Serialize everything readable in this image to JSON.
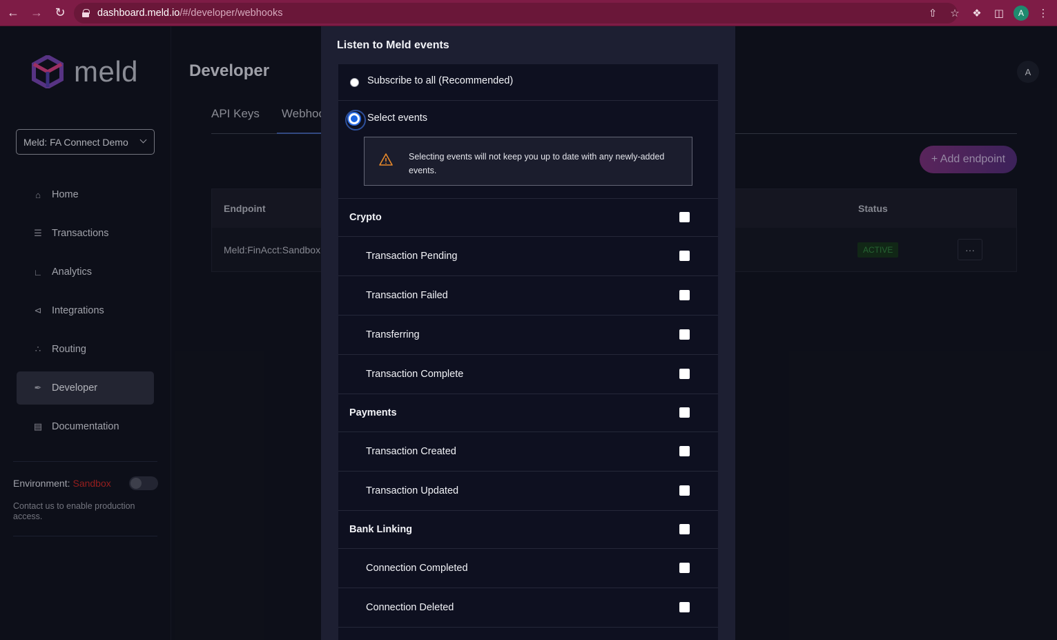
{
  "browser": {
    "url_host": "dashboard.meld.io",
    "url_path": "/#/developer/webhooks",
    "profile_initial": "A"
  },
  "sidebar": {
    "logo_text": "meld",
    "account_select": "Meld: FA Connect Demo",
    "items": [
      {
        "label": "Home",
        "icon": "home-icon"
      },
      {
        "label": "Transactions",
        "icon": "list-icon"
      },
      {
        "label": "Analytics",
        "icon": "chart-icon"
      },
      {
        "label": "Integrations",
        "icon": "share-icon"
      },
      {
        "label": "Routing",
        "icon": "routing-icon"
      },
      {
        "label": "Developer",
        "icon": "wrench-icon"
      },
      {
        "label": "Documentation",
        "icon": "book-icon"
      }
    ],
    "environment_label": "Environment:",
    "environment_value": "Sandbox",
    "environment_help": "Contact us to enable production access."
  },
  "main": {
    "title": "Developer",
    "tabs": [
      "API Keys",
      "Webhooks"
    ],
    "avatar_initial": "A",
    "add_endpoint_label": "+ Add endpoint",
    "table": {
      "headers": {
        "endpoint": "Endpoint",
        "status": "Status"
      },
      "rows": [
        {
          "endpoint": "Meld:FinAcct:Sandbox",
          "status": "ACTIVE",
          "more": "···"
        }
      ]
    }
  },
  "modal": {
    "title": "Listen to Meld events",
    "subscribe_all_label": "Subscribe to all (Recommended)",
    "select_events_label": "Select events",
    "warning_text": "Selecting events will not keep you up to date with any newly-added events.",
    "groups": [
      {
        "name": "Crypto",
        "events": [
          "Transaction Pending",
          "Transaction Failed",
          "Transferring",
          "Transaction Complete"
        ]
      },
      {
        "name": "Payments",
        "events": [
          "Transaction Created",
          "Transaction Updated"
        ]
      },
      {
        "name": "Bank Linking",
        "events": [
          "Connection Completed",
          "Connection Deleted"
        ]
      }
    ]
  },
  "colors": {
    "chrome": "#7e1c46",
    "accent_blue": "#1a63e0",
    "sandbox_red": "#b52525",
    "warning_orange": "#e8892b"
  }
}
